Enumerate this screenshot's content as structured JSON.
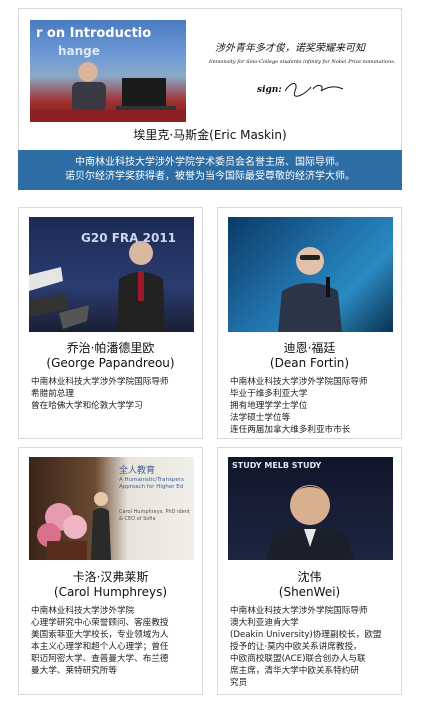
{
  "hero": {
    "photo_slide_text": "r on Introductio",
    "photo_slide_text2": "hange",
    "quote": "涉外青年多才俊，诺奖荣耀来可知",
    "dedication": "Immensity for Sino-College students infinity for Nobel Prize nominations.",
    "sign_label": "sign:",
    "name": "埃里克·马斯金(Eric Maskin)"
  },
  "banner": {
    "line1": "中南林业科技大学涉外学院学术委员会名誉主席、国际导师。",
    "line2": "诺贝尔经济学奖获得者，被誉为当今国际最受尊敬的经济学大师。"
  },
  "people": [
    {
      "name_cn": "乔治·帕潘德里欧",
      "name_en": "(George Papandreou)",
      "photo_text": "G20 FRA 2011",
      "desc": [
        "中南林业科技大学涉外学院国际导师",
        "希腊前总理",
        "曾在哈佛大学和伦敦大学学习"
      ]
    },
    {
      "name_cn": "迪恩·福廷",
      "name_en": "(Dean Fortin)",
      "photo_text": "",
      "desc": [
        "中南林业科技大学涉外学院国际导师",
        "毕业于维多利亚大学",
        "拥有地理学学士学位",
        "法学硕士学位等",
        "连任两届加拿大维多利亚市市长"
      ]
    },
    {
      "name_cn": "卡洛·汉弗莱斯",
      "name_en": "(Carol Humphreys)",
      "photo_text": "全人教育",
      "photo_text2": "A Humanistic/Transpers Approach for Higher Ed",
      "photo_text3": "Carol Humphreys, PhD ident & CEO of Sofia",
      "desc": [
        "中南林业科技大学涉外学院",
        "心理学研究中心荣誉顾问、客座教授",
        "美国索菲亚大学校长，专业领域为人",
        "本主义心理学和超个人心理学；曾任",
        "职迈阿密大学、查普曼大学、布兰德",
        "曼大学、莱特研究所等"
      ]
    },
    {
      "name_cn": "沈伟",
      "name_en": "(ShenWei)",
      "photo_text": "STUDY MELB   STUDY",
      "desc": [
        "中南林业科技大学涉外学院国际导师",
        "澳大利亚迪肯大学",
        "(Deakin University)协理副校长，欧盟",
        "授予的让·莫内中欧关系讲席教授，",
        "中欧商校联盟(ACE)联合创办人与联",
        "席主席，清华大学中欧关系特约研",
        "究员"
      ]
    }
  ]
}
